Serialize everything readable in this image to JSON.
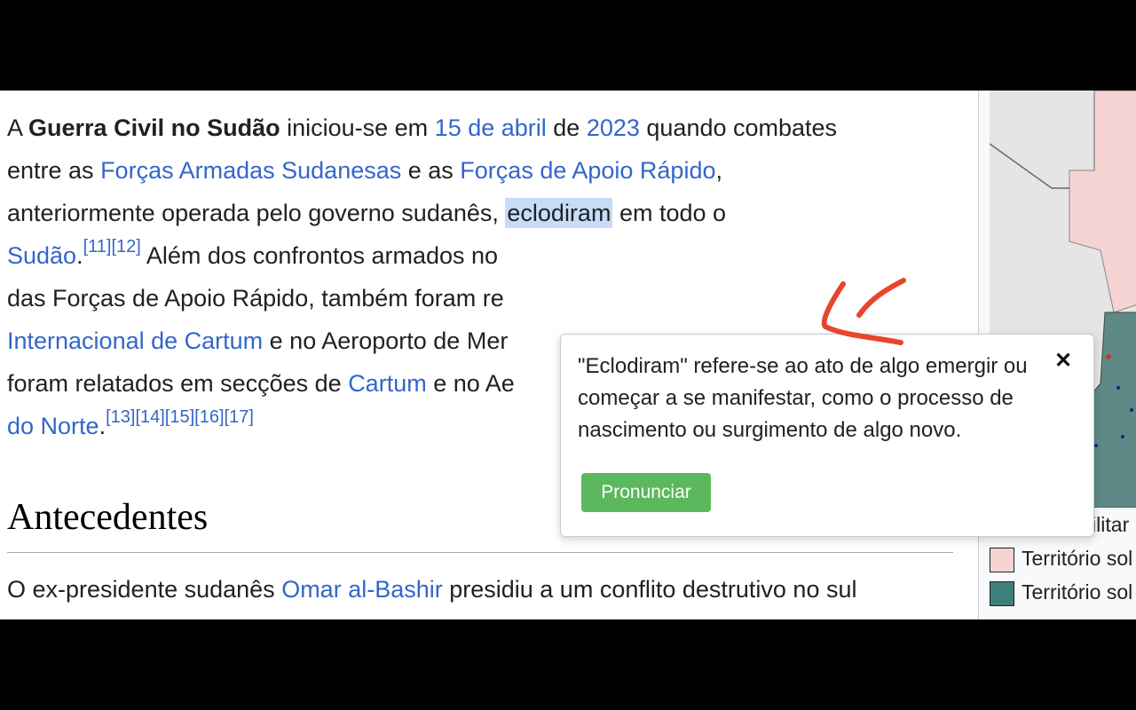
{
  "article": {
    "lines": [
      {
        "a": "A ",
        "b": "Guerra Civil no Sudão",
        "c": " iniciou-se em ",
        "d": "15 de abril",
        "e": " de ",
        "f": "2023",
        "g": " quando combates"
      },
      {
        "a": "entre as ",
        "b": "Forças Armadas Sudanesas",
        "c": " e as ",
        "d": "Forças de Apoio Rápido",
        "e": ","
      },
      {
        "a": "anteriormente operada pelo governo sudanês, ",
        "b": "eclodiram",
        "c": " em todo o"
      },
      {
        "a": "Sudão",
        "b": ".",
        "c": "[11]",
        "d": "[12]",
        "e": " Além dos confrontos armados no"
      },
      {
        "a": "das Forças de Apoio Rápido, também foram re"
      },
      {
        "a": "Internacional de Cartum",
        "b": " e no Aeroporto de Mer"
      },
      {
        "a": "foram relatados em secções de ",
        "b": "Cartum",
        "c": " e no Ae"
      },
      {
        "a": "do Norte",
        "b": ".",
        "c": "[13]",
        "d": "[14]",
        "e": "[15]",
        "f": "[16]",
        "g": "[17]"
      }
    ]
  },
  "section": {
    "heading": "Antecedentes",
    "para": {
      "a": "O ex-presidente sudanês ",
      "b": "Omar al-Bashir",
      "c": " presidiu a um conflito destrutivo no sul"
    }
  },
  "infobox": {
    "legend_title": "Situação militar",
    "legend": [
      {
        "label": "Território sol",
        "color": "#f6d3d3"
      },
      {
        "label": "Território sol",
        "color": "#3f7f7b"
      }
    ]
  },
  "popup": {
    "text": "\"Eclodiram\" refere-se ao ato de algo emergir ou começar a se manifestar, como o processo de nascimento ou surgimento de algo novo.",
    "button_label": "Pronunciar",
    "close_symbol": "✕"
  },
  "colors": {
    "link": "#3366cc",
    "button": "#5cb85c",
    "highlight": "#c6dcf7",
    "annotation": "#e8452c"
  }
}
